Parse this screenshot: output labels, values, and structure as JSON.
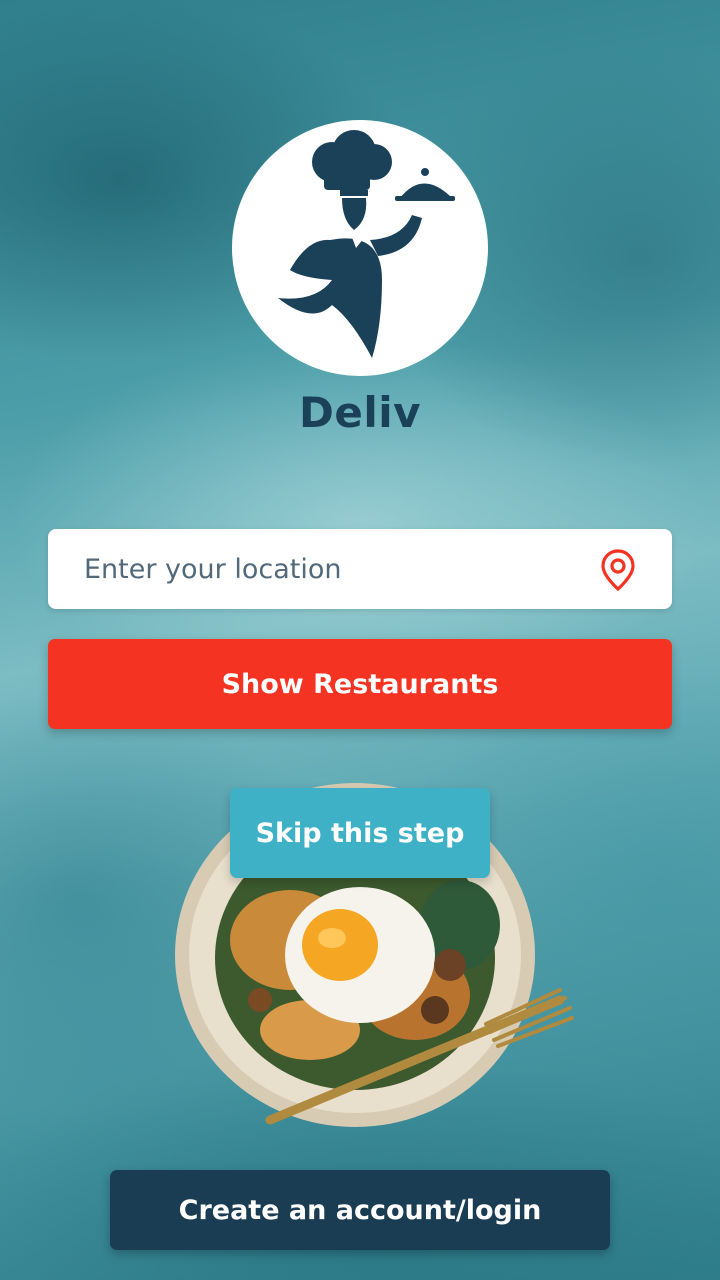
{
  "app": {
    "name": "Deliv"
  },
  "location": {
    "placeholder": "Enter your location",
    "value": ""
  },
  "actions": {
    "show_restaurants": "Show Restaurants",
    "skip": "Skip this step",
    "create_account": "Create an account/login"
  },
  "icons": {
    "logo": "chef-waiter-logo-icon",
    "location": "map-pin-icon"
  },
  "colors": {
    "brand_dark": "#1b4159",
    "primary_red": "#f43322",
    "skip_teal": "#3fb1c6",
    "account_navy": "#1b3d54"
  }
}
